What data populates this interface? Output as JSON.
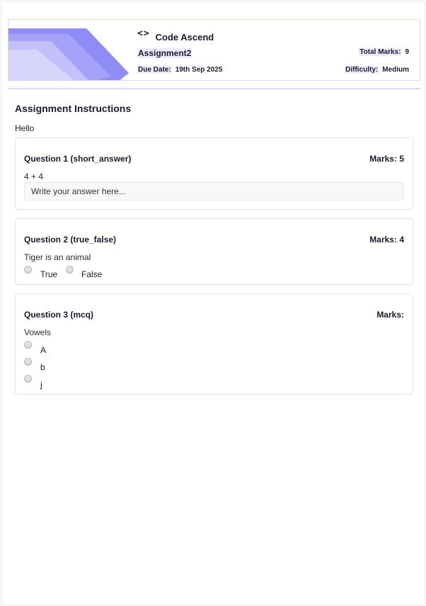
{
  "brand": {
    "icon": "code-brackets-icon",
    "name": "Code Ascend"
  },
  "assignment": {
    "title": "Assignment2",
    "due_label": "Due Date:",
    "due_value": "19th Sep 2025",
    "total_marks_label": "Total Marks:",
    "total_marks_value": "9",
    "difficulty_label": "Difficulty:",
    "difficulty_value": "Medium"
  },
  "instructions": {
    "title": "Assignment Instructions",
    "body": "Hello"
  },
  "questions": [
    {
      "header": "Question 1 (short_answer)",
      "marks": "Marks: 5",
      "text": "4 + 4",
      "answer_placeholder": "Write your answer here..."
    },
    {
      "header": "Question 2 (true_false)",
      "marks": "Marks: 4",
      "text": "Tiger is an animal",
      "options": [
        "True",
        "False"
      ]
    },
    {
      "header": "Question 3 (mcq)",
      "marks": "Marks:",
      "text": "Vowels",
      "options": [
        "A",
        "b",
        "j"
      ]
    }
  ],
  "colors": {
    "accent": "#8f8cf7",
    "accent_light": "#c9c6fb",
    "border": "#d9d6fb"
  }
}
